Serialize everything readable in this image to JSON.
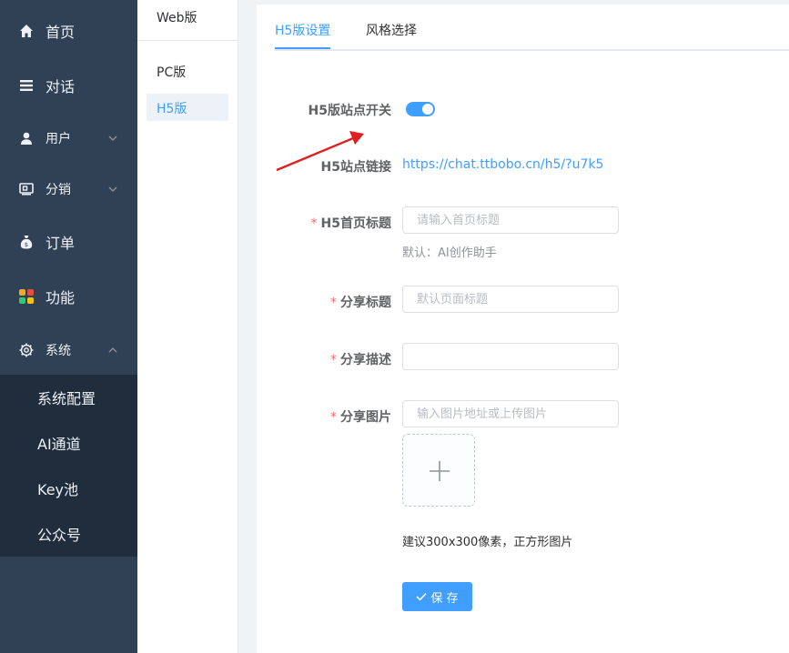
{
  "sidebar": {
    "items": [
      {
        "label": "首页",
        "icon": "home-icon"
      },
      {
        "label": "对话",
        "icon": "list-icon"
      },
      {
        "label": "用户",
        "icon": "user-icon"
      },
      {
        "label": "分销",
        "icon": "distribution-icon"
      },
      {
        "label": "订单",
        "icon": "money-bag-icon"
      },
      {
        "label": "功能",
        "icon": "apps-icon"
      },
      {
        "label": "系统",
        "icon": "gear-icon"
      }
    ],
    "system_submenu": [
      "系统配置",
      "AI通道",
      "Key池",
      "公众号"
    ]
  },
  "secondary_menu": {
    "header": "Web版",
    "items": [
      "PC版",
      "H5版"
    ],
    "active": "H5版"
  },
  "tabs": [
    {
      "label": "H5版设置",
      "active": true
    },
    {
      "label": "风格选择",
      "active": false
    }
  ],
  "form": {
    "switch_label": "H5版站点开关",
    "switch_on": true,
    "link_label": "H5站点链接",
    "link_value": "https://chat.ttbobo.cn/h5/?u7k5",
    "home_title_label": "H5首页标题",
    "home_title_placeholder": "请输入首页标题",
    "home_title_hint": "默认：AI创作助手",
    "share_title_label": "分享标题",
    "share_title_placeholder": "默认页面标题",
    "share_desc_label": "分享描述",
    "share_desc_value": "",
    "share_image_label": "分享图片",
    "share_image_placeholder": "输入图片地址或上传图片",
    "image_tip": "建议300x300像素，正方形图片",
    "save_label": "保 存",
    "required_mark": "*"
  },
  "colors": {
    "sidebar_bg": "#304156",
    "submenu_bg": "#1f2d3d",
    "accent": "#409eff",
    "required": "#f56c6c",
    "annotation_arrow": "#e02020"
  }
}
